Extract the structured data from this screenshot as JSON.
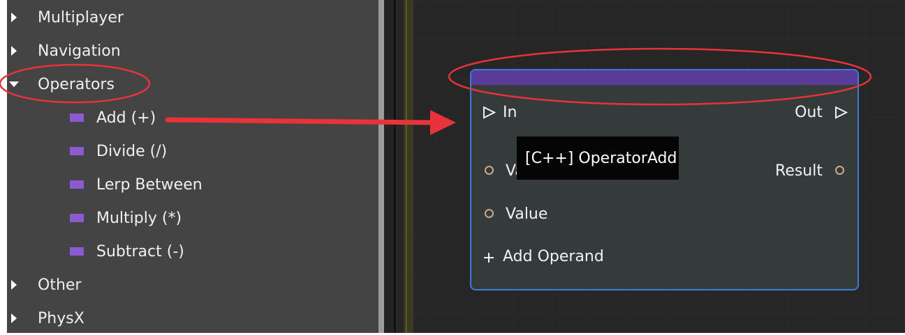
{
  "tree": {
    "items": [
      {
        "label": "Multiplayer",
        "expanded": false
      },
      {
        "label": "Navigation",
        "expanded": false
      },
      {
        "label": "Operators",
        "expanded": true
      },
      {
        "label": "Other",
        "expanded": false
      },
      {
        "label": "PhysX",
        "expanded": false
      }
    ],
    "operators_children": [
      {
        "label": "Add (+)"
      },
      {
        "label": "Divide (/)"
      },
      {
        "label": "Lerp Between"
      },
      {
        "label": "Multiply (*)"
      },
      {
        "label": "Subtract (-)"
      }
    ]
  },
  "node": {
    "in_label": "In",
    "out_label": "Out",
    "value1_label": "Va",
    "result_label": "Result",
    "value2_label": "Value",
    "add_operand_label": "Add Operand"
  },
  "tooltip": {
    "text": "[C++] OperatorAdd"
  },
  "colors": {
    "node_header": "#5b3b99",
    "node_border": "#3d7bdb",
    "node_swatch": "#8a5cd0",
    "annotation": "#e8333b"
  }
}
